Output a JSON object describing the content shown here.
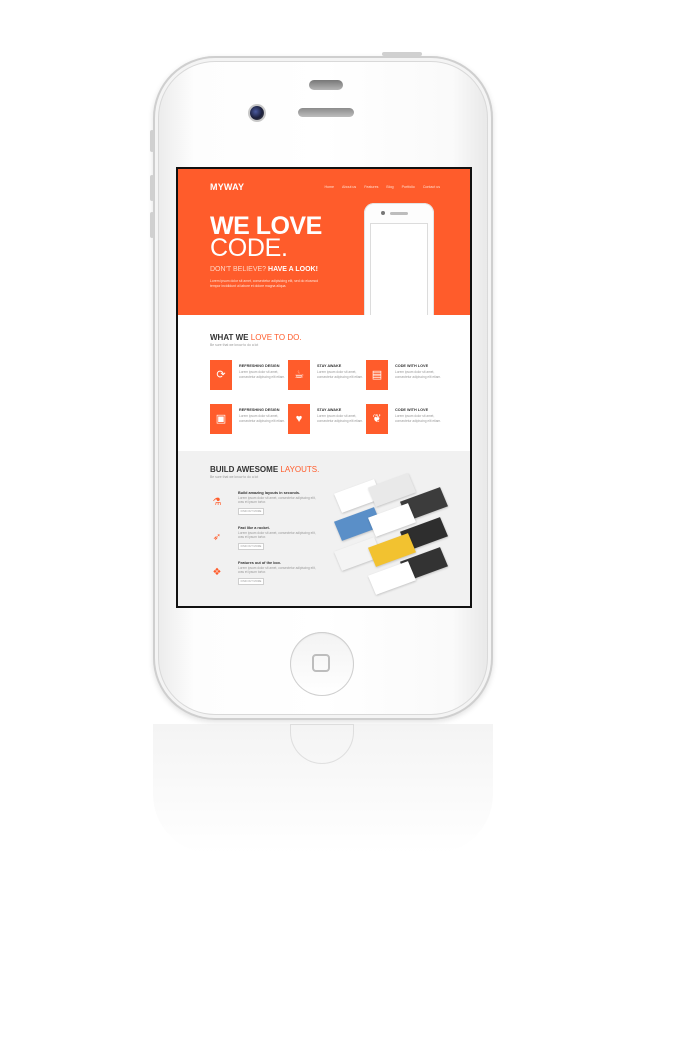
{
  "site": {
    "logo": "MYWAY",
    "nav": [
      "Home",
      "About us",
      "Features",
      "Blog",
      "Portfolio",
      "Contact us"
    ]
  },
  "hero": {
    "line1": "WE LOVE",
    "line2": "CODE.",
    "tagline_light": "DON'T BELIEVE?",
    "tagline_bold": "HAVE A LOOK!",
    "body": "Lorem ipsum dolor sit amet, consectetur adipisicing elit, sed do eiusmod tempor incididunt ut labore et dolore magna aliqua."
  },
  "what": {
    "title_bold": "WHAT WE",
    "title_light": "LOVE TO DO.",
    "subtitle": "Be sure that we know to do a lot",
    "features": [
      {
        "title": "REFRESHING DESIGN",
        "text": "Lorem ipsum dolor sit amet, consectetur adipiscing elit etiam.",
        "icon": "refresh-icon",
        "glyph": "⟳"
      },
      {
        "title": "STAY AWAKE",
        "text": "Lorem ipsum dolor sit amet, consectetur adipiscing elit etiam.",
        "icon": "coffee-cup-icon",
        "glyph": "☕"
      },
      {
        "title": "CODE WITH LOVE",
        "text": "Lorem ipsum dolor sit amet, consectetur adipiscing elit etiam.",
        "icon": "document-icon",
        "glyph": "▤"
      },
      {
        "title": "REFRESHING DESIGN",
        "text": "Lorem ipsum dolor sit amet, consectetur adipiscing elit etiam.",
        "icon": "floppy-disk-icon",
        "glyph": "▣"
      },
      {
        "title": "STAY AWAKE",
        "text": "Lorem ipsum dolor sit amet, consectetur adipiscing elit etiam.",
        "icon": "heart-icon",
        "glyph": "♥"
      },
      {
        "title": "CODE WITH LOVE",
        "text": "Lorem ipsum dolor sit amet, consectetur adipiscing elit etiam.",
        "icon": "leaf-icon",
        "glyph": "❦"
      }
    ]
  },
  "build": {
    "title_bold": "BUILD AWESOME",
    "title_light": "LAYOUTS.",
    "subtitle": "Be sure that we know to do a lot",
    "items": [
      {
        "title": "Build amazing layouts in seconds.",
        "text": "Lorem ipsum dolor sit amet, consectetur adipiscing elit, cras et ipsum tortor.",
        "button": "FIND OUT MORE",
        "icon": "flask-icon",
        "glyph": "⚗"
      },
      {
        "title": "Fast like a rocket.",
        "text": "Lorem ipsum dolor sit amet, consectetur adipiscing elit, cras et ipsum tortor.",
        "button": "FIND OUT MORE",
        "icon": "rocket-icon",
        "glyph": "➶"
      },
      {
        "title": "Features out of the box.",
        "text": "Lorem ipsum dolor sit amet, consectetur adipiscing elit, cras et ipsum tortor.",
        "button": "FIND OUT MORE",
        "icon": "dropbox-icon",
        "glyph": "❖"
      }
    ]
  },
  "colors": {
    "accent": "#ff5c2b",
    "section_gray": "#f1f1f1",
    "text_dark": "#333333"
  }
}
